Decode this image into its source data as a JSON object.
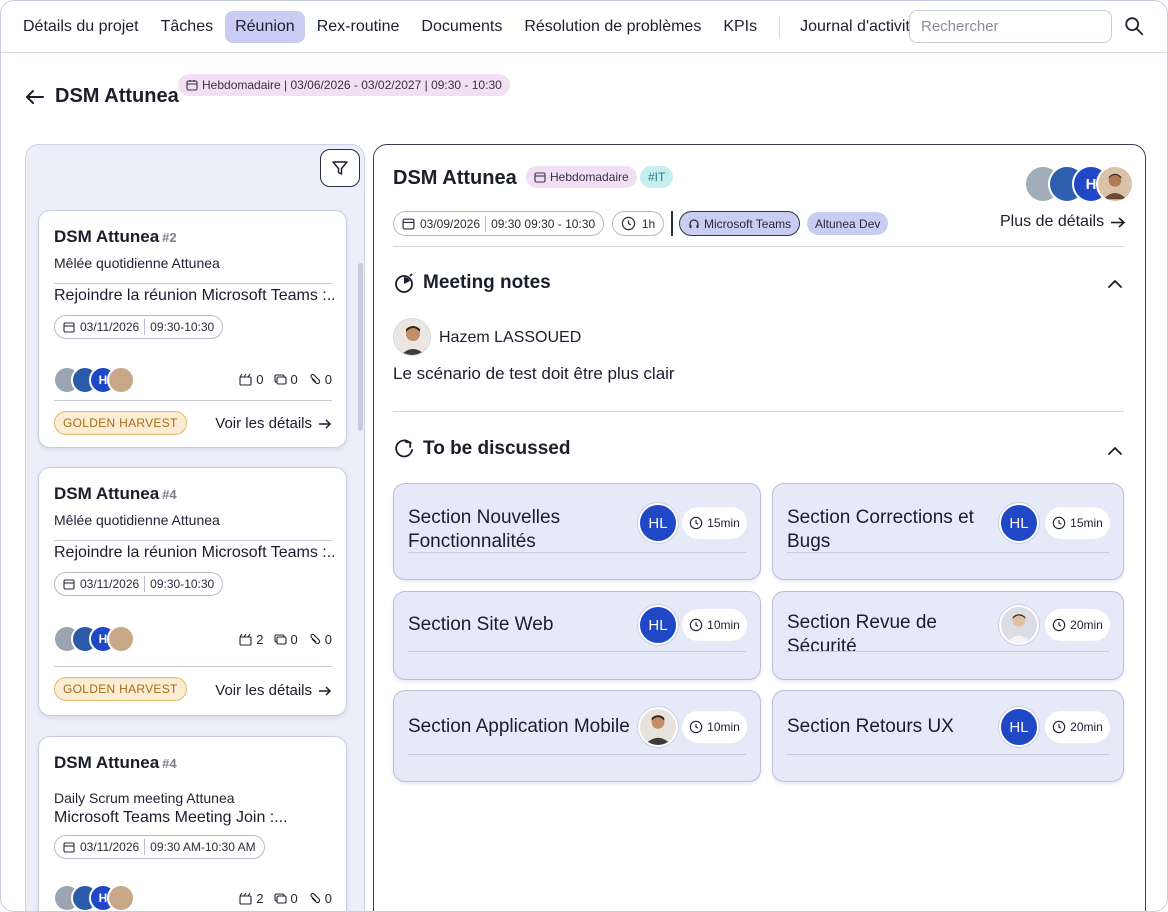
{
  "nav": {
    "tabs": [
      "Détails du projet",
      "Tâches",
      "Réunion",
      "Rex-routine",
      "Documents",
      "Résolution de problèmes",
      "KPIs"
    ],
    "active_tab": "Réunion",
    "journal": "Journal d'activité",
    "search_placeholder": "Rechercher"
  },
  "header": {
    "title": "DSM Attunea",
    "recurrence": "Hebdomadaire | 03/06/2026 - 03/02/2027 | 09:30 - 10:30"
  },
  "meetings": [
    {
      "title": "DSM Attunea",
      "number": "#2",
      "subtitle": "Mêlée quotidienne Attunea",
      "join": "Rejoindre la réunion Microsoft Teams :...",
      "date": "03/11/2026",
      "time": "09:30-10:30",
      "stats": [
        "0",
        "0",
        "0"
      ],
      "badge": "GOLDEN HARVEST",
      "details": "Voir les détails"
    },
    {
      "title": "DSM Attunea",
      "number": "#4",
      "subtitle": "Mêlée quotidienne Attunea",
      "join": "Rejoindre la réunion Microsoft Teams :...",
      "date": "03/11/2026",
      "time": "09:30-10:30",
      "stats": [
        "2",
        "0",
        "0"
      ],
      "badge": "GOLDEN HARVEST",
      "details": "Voir les détails"
    },
    {
      "title": "DSM Attunea",
      "number": "#4",
      "subtitle": "Daily Scrum meeting Attunea",
      "join": "Microsoft Teams Meeting Join :...",
      "date": "03/11/2026",
      "time": "09:30 AM-10:30 AM",
      "stats": [
        "2",
        "0",
        "0"
      ]
    }
  ],
  "detail": {
    "title": "DSM Attunea",
    "recurrence_tag": "Hebdomadaire",
    "tag": "#IT",
    "date": "03/09/2026",
    "time": "09:30 09:30 - 10:30",
    "duration": "1h",
    "platform": "Microsoft Teams",
    "team": "Altunea Dev",
    "more": "Plus de détails",
    "avatar_initial": "H"
  },
  "notes": {
    "heading": "Meeting notes",
    "author": "Hazem LASSOUED",
    "text": "Le scénario de test doit être plus clair"
  },
  "discuss": {
    "heading": "To be discussed",
    "items": [
      {
        "title": "Section Nouvelles Fonctionnalités",
        "owner": "HL",
        "duration": "15min"
      },
      {
        "title": "Section Corrections et Bugs",
        "owner": "HL",
        "duration": "15min"
      },
      {
        "title": "Section Site Web",
        "owner": "HL",
        "duration": "10min"
      },
      {
        "title": "Section Revue de Sécurité",
        "owner": "photo",
        "duration": "20min"
      },
      {
        "title": "Section Application Mobile",
        "owner": "photo",
        "duration": "10min"
      },
      {
        "title": "Section Retours UX",
        "owner": "HL",
        "duration": "20min"
      }
    ]
  },
  "colors": {
    "accent": "#c9cdf3",
    "hl_blue": "#1f47c6",
    "golden": "#e4b66e",
    "tag_it": "#c6eeee"
  }
}
